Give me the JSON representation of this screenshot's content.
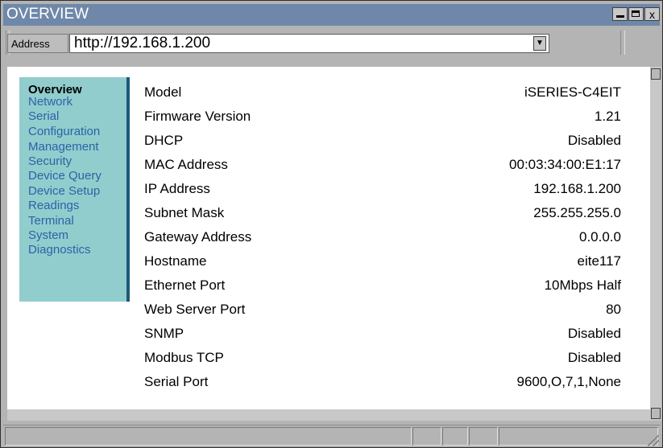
{
  "window": {
    "title": "OVERVIEW",
    "buttons": {
      "minimize": "",
      "maximize": "",
      "close": "x"
    }
  },
  "address_bar": {
    "label": "Address",
    "url": "http://192.168.1.200",
    "dropdown_icon": "chevron-down-icon"
  },
  "sidebar": {
    "items": [
      {
        "label": "Overview",
        "active": true
      },
      {
        "label": "Network"
      },
      {
        "label": "Serial"
      },
      {
        "label": "Configuration"
      },
      {
        "label": "Management"
      },
      {
        "label": "Security"
      },
      {
        "label": "Device Query"
      },
      {
        "label": "Device Setup"
      },
      {
        "label": "Readings"
      },
      {
        "label": "Terminal"
      },
      {
        "label": "System"
      },
      {
        "label": "Diagnostics"
      }
    ]
  },
  "overview": {
    "rows": [
      {
        "label": "Model",
        "value": "iSERIES-C4EIT"
      },
      {
        "label": "Firmware Version",
        "value": "1.21"
      },
      {
        "label": "DHCP",
        "value": "Disabled"
      },
      {
        "label": "MAC Address",
        "value": "00:03:34:00:E1:17"
      },
      {
        "label": "IP Address",
        "value": "192.168.1.200"
      },
      {
        "label": "Subnet Mask",
        "value": "255.255.255.0"
      },
      {
        "label": "Gateway Address",
        "value": "0.0.0.0"
      },
      {
        "label": "Hostname",
        "value": "eite117"
      },
      {
        "label": "Ethernet Port",
        "value": "10Mbps Half"
      },
      {
        "label": "Web Server Port",
        "value": "80"
      },
      {
        "label": "SNMP",
        "value": "Disabled"
      },
      {
        "label": "Modbus TCP",
        "value": "Disabled"
      },
      {
        "label": "Serial Port",
        "value": "9600,O,7,1,None"
      }
    ]
  },
  "colors": {
    "titlebar": "#6f88a9",
    "sidebar_bg": "#91cdcd",
    "sidebar_border": "#1b5a7a",
    "link": "#2b63a6"
  }
}
